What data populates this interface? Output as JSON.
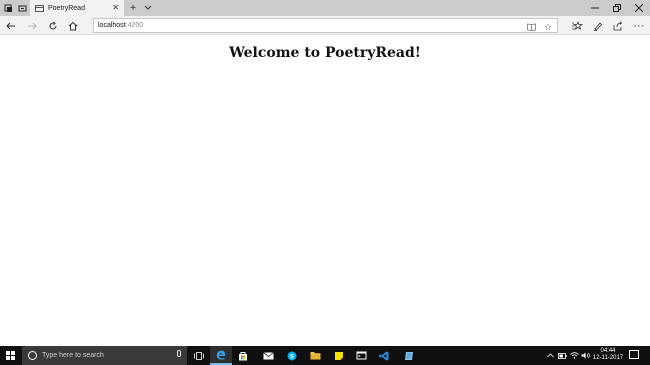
{
  "browser": {
    "tab_title": "PoetryRead",
    "address": {
      "host": "localhost",
      "port": ":4200"
    }
  },
  "page": {
    "heading": "Welcome to PoetryRead!"
  },
  "taskbar": {
    "search_placeholder": "Type here to search",
    "clock": {
      "time": "04:44",
      "date": "12-11-2017"
    }
  },
  "colors": {
    "accent": "#0078d7",
    "taskbar_bg": "#101010",
    "titlebar_bg": "#cccccc",
    "active_indicator": "#76b9ed"
  }
}
